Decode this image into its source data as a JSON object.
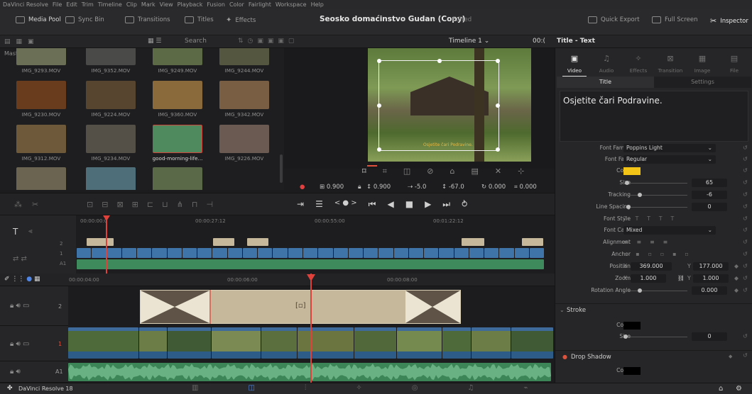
{
  "menubar": {
    "items": [
      "DaVinci Resolve",
      "File",
      "Edit",
      "Trim",
      "Timeline",
      "Clip",
      "Mark",
      "View",
      "Playback",
      "Fusion",
      "Color",
      "Fairlight",
      "Workspace",
      "Help"
    ]
  },
  "toolbar": {
    "media_pool": "Media Pool",
    "sync_bin": "Sync Bin",
    "transitions": "Transitions",
    "titles": "Titles",
    "effects": "Effects",
    "project_title": "Seosko domaćinstvo Gudan (Copy)",
    "edited": "Edited",
    "quick_export": "Quick Export",
    "full_screen": "Full Screen",
    "inspector": "Inspector"
  },
  "bar2": {
    "search_placeholder": "Search",
    "timeline_name": "Timeline 1",
    "timecode": "00:(",
    "inspector_title": "Title - Text"
  },
  "media_pool": {
    "bin": "Master",
    "clips": [
      {
        "name": "IMG_9293.MOV",
        "color": "#6a6f55"
      },
      {
        "name": "IMG_9352.MOV",
        "color": "#4a4a48"
      },
      {
        "name": "IMG_9249.MOV",
        "color": "#5c6a45"
      },
      {
        "name": "IMG_9244.MOV",
        "color": "#55563f"
      },
      {
        "name": "IMG_9230.MOV",
        "color": "#6a3c1e"
      },
      {
        "name": "IMG_9224.MOV",
        "color": "#58452f"
      },
      {
        "name": "IMG_9360.MOV",
        "color": "#8a6a3a"
      },
      {
        "name": "IMG_9342.MOV",
        "color": "#7a5e44"
      },
      {
        "name": "IMG_9312.MOV",
        "color": "#6e5a3a"
      },
      {
        "name": "IMG_9234.MOV",
        "color": "#555047"
      },
      {
        "name": "good-morning-life...",
        "color": "#4f8a5e"
      },
      {
        "name": "IMG_9226.MOV",
        "color": "#6b5a52"
      },
      {
        "name": "",
        "color": "#6a6450"
      },
      {
        "name": "",
        "color": "#4e6e7a"
      },
      {
        "name": "",
        "color": "#5a6a48"
      }
    ]
  },
  "viewer": {
    "overlay_text": "Osjetite čari Podravine.",
    "zoom_x": "0.900",
    "zoom_y": "0.900",
    "pos_x": "-5.0",
    "pos_y": "-67.0",
    "rotation": "0.000",
    "crop": "0.000"
  },
  "mini_timeline": {
    "ticks": [
      "00:00:00:0",
      "00:00:27:12",
      "00:00:55:00",
      "00:01:22:12"
    ],
    "track_v": "2",
    "track_v1": "1",
    "track_a": "A1"
  },
  "main_timeline": {
    "ticks": [
      "00:00:04:00",
      "00:00:06:00",
      "00:00:08:00"
    ],
    "tracks": [
      {
        "label": "2"
      },
      {
        "label": "1"
      },
      {
        "label": "A1"
      }
    ]
  },
  "inspector": {
    "tabs": [
      "Video",
      "Audio",
      "Effects",
      "Transition",
      "Image",
      "File"
    ],
    "subtabs": [
      "Title",
      "Settings"
    ],
    "text": "Osjetite čari Podravine.",
    "font_family_label": "Font Family",
    "font_family": "Poppins Light",
    "font_face_label": "Font Face",
    "font_face": "Regular",
    "color_label": "Color",
    "color": "#f2c418",
    "size_label": "Size",
    "size": "65",
    "size_level": 0.05,
    "tracking_label": "Tracking",
    "tracking": "-6",
    "tracking_level": 0.25,
    "line_spacing_label": "Line Spacing",
    "line_spacing": "0",
    "line_spacing_level": 0.08,
    "font_style_label": "Font Style",
    "font_case_label": "Font Case",
    "font_case": "Mixed",
    "alignment_label": "Alignment",
    "anchor_label": "Anchor",
    "position_label": "Position",
    "pos_x": "369.000",
    "pos_y": "177.000",
    "zoom_label": "Zoom",
    "zoom_x": "1.000",
    "zoom_y": "1.000",
    "rotation_label": "Rotation Angle",
    "rotation": "0.000",
    "rotation_level": 0.25,
    "stroke_header": "Stroke",
    "stroke_color_label": "Color",
    "stroke_color": "#000000",
    "stroke_size_label": "Size",
    "stroke_size": "0",
    "drop_shadow_header": "Drop Shadow",
    "shadow_color_label": "Color",
    "shadow_color": "#000000",
    "x_prefix": "X",
    "y_prefix": "Y"
  },
  "bottombar": {
    "app_name": "DaVinci Resolve 18"
  }
}
